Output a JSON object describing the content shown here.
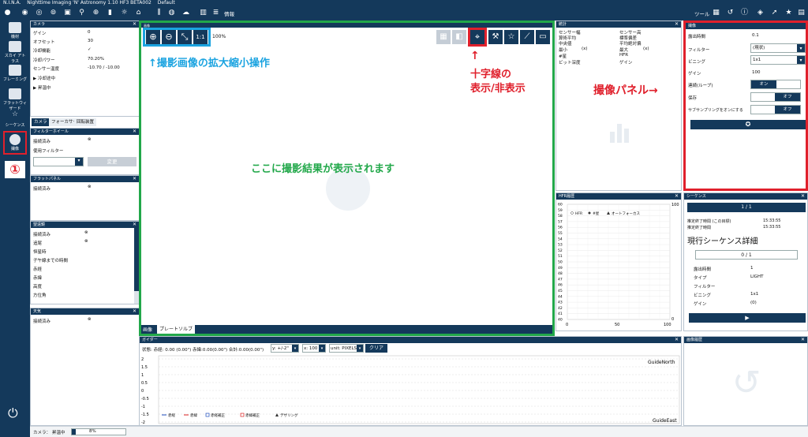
{
  "titlebar": {
    "app": "N.I.N.A.",
    "title": "Nighttime Imaging 'N' Astronomy 1.10 HF3 BETA002",
    "profile": "Default"
  },
  "toolbar": {
    "info_label": "情報",
    "tools_label": "ツール"
  },
  "sidebar": {
    "items": [
      {
        "label": "機材",
        "icon": "telescope-icon"
      },
      {
        "label": "スカイ アトラス",
        "icon": "atlas-icon"
      },
      {
        "label": "フレーミング",
        "icon": "framing-icon"
      },
      {
        "label": "フラットウィザード",
        "icon": "flat-wizard-icon"
      },
      {
        "label": "シーケンス",
        "icon": "sequence-icon"
      },
      {
        "label": "撮像",
        "icon": "imaging-icon"
      }
    ],
    "power_icon": "power-icon"
  },
  "camera": {
    "title": "カメラ",
    "rows": [
      {
        "k": "ゲイン",
        "v": "0"
      },
      {
        "k": "オフセット",
        "v": "30"
      },
      {
        "k": "冷却機能",
        "v": "✓"
      },
      {
        "k": "冷却パワー",
        "v": "70.20%"
      },
      {
        "k": "センサー温度",
        "v": "-10.70 / -10.00"
      }
    ],
    "cooling": "冷却途中",
    "warming": "昇温中"
  },
  "equip_tabs": [
    "カメラ",
    "フォーカサー",
    "回転装置"
  ],
  "filterwheel": {
    "title": "フィルターホイール",
    "connected": "接続済み",
    "use_filter": "使用フィルター",
    "change": "変更"
  },
  "flatpanel": {
    "title": "フラットパネル",
    "connected": "接続済み"
  },
  "telescope": {
    "title": "望遠鏡",
    "rows": [
      "接続済み",
      "追尾",
      "恒星時",
      "子午線までの時間",
      "赤経",
      "赤緯",
      "高度",
      "方位角"
    ]
  },
  "weather": {
    "title": "天気",
    "connected": "接続済み"
  },
  "image": {
    "title": "画像",
    "zoom_pct": "100%",
    "zoom_1to1": "1:1",
    "tabs": [
      "画像",
      "プレートソルブ"
    ]
  },
  "stats": {
    "title": "統計",
    "left": [
      "センサー幅",
      "算術平均",
      "中央値",
      "最小",
      "#星",
      "ビット深度"
    ],
    "left_x": "(x)",
    "right": [
      "センサー高",
      "標準偏差",
      "平均絶対偏",
      "最大",
      "HFR",
      "ゲイン"
    ],
    "right_x": "(x)"
  },
  "hfr": {
    "title": "HFR履歴",
    "legend": [
      "HFR",
      "#星",
      "オートフォーカス"
    ],
    "yticks_left": [
      "60",
      "59",
      "58",
      "57",
      "56",
      "55",
      "54",
      "53",
      "52",
      "51",
      "50",
      "49",
      "48",
      "47",
      "46",
      "45",
      "44",
      "43",
      "42",
      "41",
      "40"
    ],
    "yticks_right": [
      "100",
      "0"
    ],
    "xticks": [
      "0",
      "50",
      "100"
    ]
  },
  "imaging": {
    "title": "撮像",
    "rows": [
      {
        "k": "露出時間",
        "v": "0.1"
      },
      {
        "k": "フィルター",
        "v": "(現状)"
      },
      {
        "k": "ビニング",
        "v": "1x1"
      },
      {
        "k": "ゲイン",
        "v": "100"
      }
    ],
    "loop": "連続(ループ)",
    "loop_on": "オン",
    "save": "保存",
    "save_off": "オフ",
    "subsample": "サブサンプリングをオンにする",
    "subsample_off": "オフ"
  },
  "sequence": {
    "title": "シーケンス",
    "progress": "1 / 1",
    "end_label1": "推定終了時間 (この目標)",
    "end_val1": "15:33:55",
    "end_label2": "推定終了時間",
    "end_val2": "15:33:55",
    "detail_title": "現行シーケンス詳細",
    "detail_progress": "0 / 1",
    "rows": [
      {
        "k": "露出時間",
        "v": "1"
      },
      {
        "k": "タイプ",
        "v": "LIGHT"
      },
      {
        "k": "フィルター",
        "v": ""
      },
      {
        "k": "ビニング",
        "v": "1x1"
      },
      {
        "k": "ゲイン",
        "v": "(0)"
      }
    ]
  },
  "guider": {
    "title": "ガイダー",
    "status": "状態: 赤経: 0.00 (0.00\") 赤緯:0.00(0.00\") 合計:0.00(0.00\")",
    "y_sel": "y: +/-2\"",
    "x_sel": "x: 100",
    "unit_sel": "unit: PIXELS",
    "clear": "クリア",
    "north": "GuideNorth",
    "east": "GuideEast",
    "yticks": [
      "2",
      "1.5",
      "1",
      "0.5",
      "0",
      "-0.5",
      "-1",
      "-1.5",
      "-2"
    ],
    "legend": [
      "赤経",
      "赤緯",
      "赤経補正",
      "赤緯補正",
      "デザリング"
    ]
  },
  "history": {
    "title": "画像履歴"
  },
  "statusbar": {
    "camera": "カメラ：",
    "state": "昇温中",
    "pct": "8%"
  },
  "annotations": {
    "zoom": "↑撮影画像の拡大縮小操作",
    "cross_arrow": "↑",
    "cross": "十字線の",
    "cross2": "表示/非表示",
    "panel": "撮像パネル→",
    "result": "ここに撮影結果が表示されます",
    "num": "①"
  },
  "colors": {
    "navy": "#14395b",
    "green": "#22a84a",
    "red": "#e0202c",
    "blue": "#1aa3e0"
  }
}
